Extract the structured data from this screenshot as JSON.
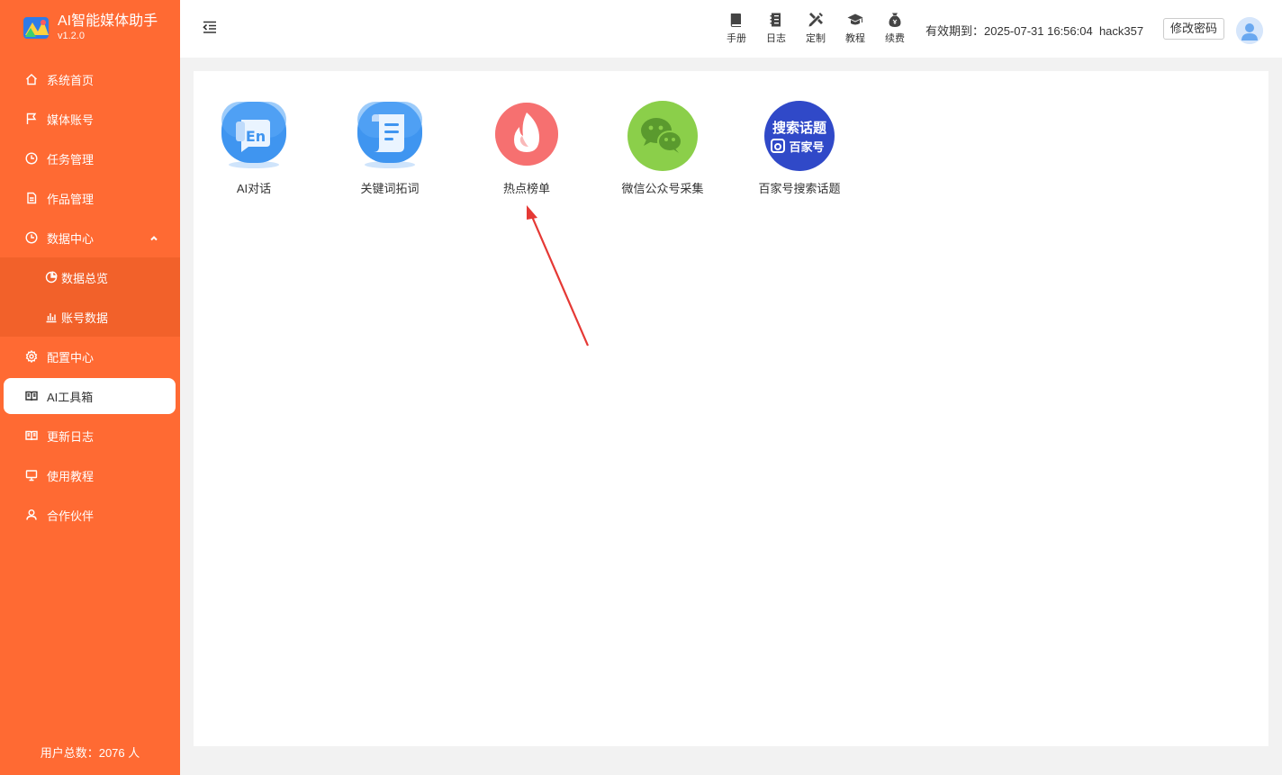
{
  "sidebar": {
    "app_title": "AI智能媒体助手",
    "version": "v1.2.0",
    "items": [
      {
        "label": "系统首页",
        "icon": "home-icon"
      },
      {
        "label": "媒体账号",
        "icon": "flag-icon"
      },
      {
        "label": "任务管理",
        "icon": "clock-icon"
      },
      {
        "label": "作品管理",
        "icon": "document-icon"
      },
      {
        "label": "数据中心",
        "icon": "clock-icon",
        "expanded": true
      },
      {
        "label": "数据总览",
        "icon": "pie-chart-icon"
      },
      {
        "label": "账号数据",
        "icon": "bar-chart-icon"
      },
      {
        "label": "配置中心",
        "icon": "gear-icon"
      },
      {
        "label": "AI工具箱",
        "icon": "book-icon",
        "active": true
      },
      {
        "label": "更新日志",
        "icon": "book-icon"
      },
      {
        "label": "使用教程",
        "icon": "monitor-icon"
      },
      {
        "label": "合作伙伴",
        "icon": "user-icon"
      }
    ],
    "user_total": "用户总数：2076 人"
  },
  "header": {
    "tools": [
      {
        "label": "手册",
        "icon": "manual-icon"
      },
      {
        "label": "日志",
        "icon": "log-icon"
      },
      {
        "label": "定制",
        "icon": "customize-icon"
      },
      {
        "label": "教程",
        "icon": "graduation-cap-icon"
      },
      {
        "label": "续费",
        "icon": "money-bag-icon"
      }
    ],
    "expiry": "有效期到：2025-07-31 16:56:04",
    "username": "hack357",
    "change_password": "修改密码"
  },
  "main": {
    "tools": [
      {
        "label": "AI对话",
        "icon": "ai-chat-icon"
      },
      {
        "label": "关键词拓词",
        "icon": "keyword-scroll-icon"
      },
      {
        "label": "热点榜单",
        "icon": "hot-flame-icon"
      },
      {
        "label": "微信公众号采集",
        "icon": "wechat-icon"
      },
      {
        "label": "百家号搜索话题",
        "icon": "baijiahao-icon",
        "badge_line1": "搜索话题",
        "badge_line2": "百家号"
      }
    ]
  },
  "colors": {
    "sidebar": "#ff6a33",
    "accent_red": "#e53935",
    "wechat_green": "#8bcf4a",
    "baijia_blue": "#3049c8"
  }
}
